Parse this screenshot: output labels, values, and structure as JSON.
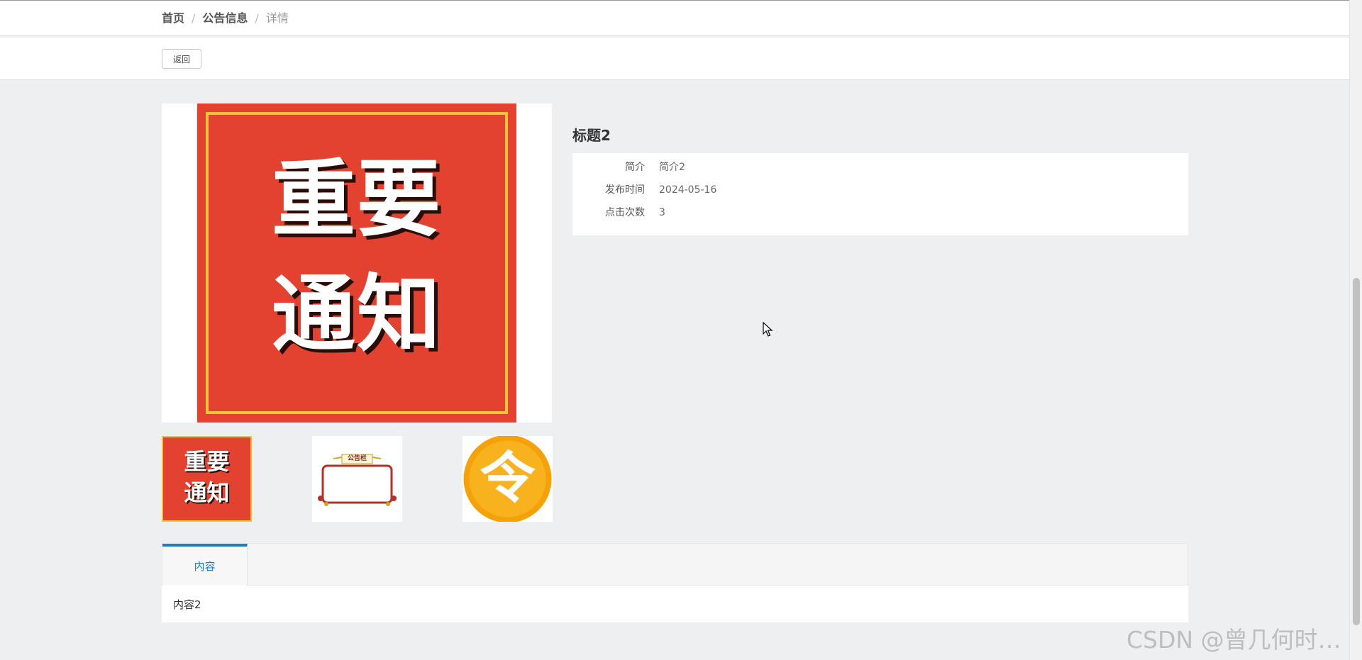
{
  "breadcrumb": {
    "home": "首页",
    "section": "公告信息",
    "current": "详情",
    "separator": "/"
  },
  "toolbar": {
    "back_label": "返回"
  },
  "gallery": {
    "main_image": {
      "line1": "重要",
      "line2": "通知"
    },
    "thumbnails": [
      {
        "line1": "重要",
        "line2": "通知"
      },
      {
        "label": "公告栏"
      },
      {
        "glyph": "令"
      }
    ]
  },
  "detail": {
    "title": "标题2",
    "fields": [
      {
        "label": "简介",
        "value": "简介2"
      },
      {
        "label": "发布时间",
        "value": "2024-05-16"
      },
      {
        "label": "点击次数",
        "value": "3"
      }
    ]
  },
  "tabs": [
    {
      "label": "内容"
    }
  ],
  "content": {
    "text": "内容2"
  },
  "watermark": {
    "text": "CSDN @曾几何时…"
  },
  "colors": {
    "accent": "#1e7ec0",
    "notice_red": "#e2422f",
    "notice_gold": "#f1c53a",
    "badge_orange": "#f5a20a"
  }
}
